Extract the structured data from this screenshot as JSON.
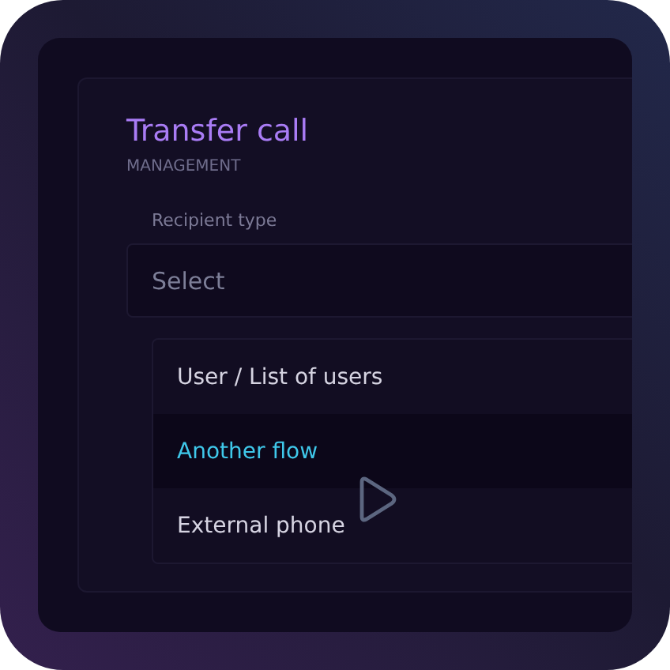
{
  "card": {
    "title": "Transfer call",
    "subtitle": "MANAGEMENT"
  },
  "field": {
    "label": "Recipient type",
    "placeholder": "Select"
  },
  "options": [
    {
      "label": "User / List of users",
      "selected": false
    },
    {
      "label": "Another flow",
      "selected": true
    },
    {
      "label": "External phone",
      "selected": false
    }
  ]
}
